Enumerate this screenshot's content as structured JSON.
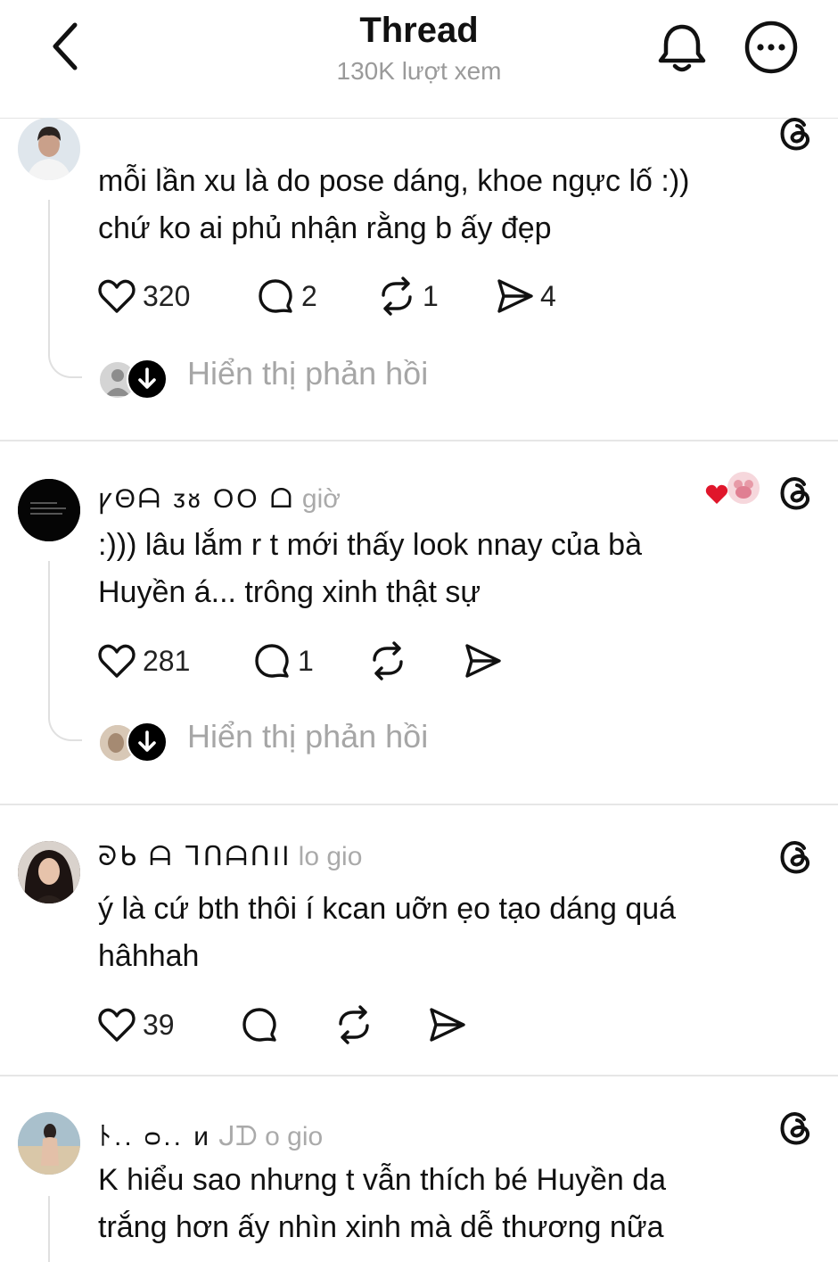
{
  "header": {
    "title": "Thread",
    "views": "130K lượt xem"
  },
  "posts": [
    {
      "username": "",
      "time": "",
      "text_line1": "mỗi lần xu là do pose dáng, khoe ngực lố :))",
      "text_line2": "chứ ko ai phủ nhận rằng b ấy đẹp",
      "likes": "320",
      "comments": "2",
      "reposts": "1",
      "shares": "4",
      "replies_label": "Hiển thị phản hồi"
    },
    {
      "username": "ꝩΘᗩ ᴣᴕ ΟΟ ᗝ",
      "time": "giờ",
      "text_line1": ":))) lâu lắm r t mới thấy look nnay của bà",
      "text_line2": "Huyền á... trông xinh thật sự",
      "likes": "281",
      "comments": "1",
      "replies_label": "Hiển thị phản hồi"
    },
    {
      "username": "ᘐᑲ ᗩ ᒣᑎᗩᑎIl",
      "time": "lo gio",
      "text_line1": "ý là cứ bth thôi í kcan uỡn ẹo tạo dáng quá",
      "text_line2": "hâhhah",
      "likes": "39"
    },
    {
      "username": "ﾄ.. ᴑ.. ᴎ",
      "time": "ᒍᗪ ο gio",
      "text_line1": "K hiểu sao nhưng t vẫn thích bé Huyền da",
      "text_line2": "trắng hơn ấy nhìn xinh mà dễ thương nữa"
    }
  ],
  "icons": {
    "back": "chevron-left-icon",
    "bell": "bell-icon",
    "more": "more-circle-icon",
    "threads": "threads-logo-icon",
    "like": "heart-icon",
    "comment": "comment-icon",
    "repost": "repost-icon",
    "share": "send-icon",
    "reply_arrow": "arrow-down-icon"
  }
}
